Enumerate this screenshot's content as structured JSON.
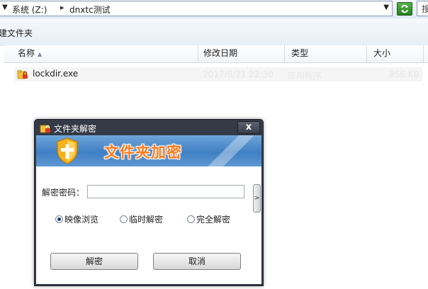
{
  "address_bar": {
    "drive": "系统 (Z:)",
    "separator": "▸",
    "folder": "dnxtc测试",
    "search_text": "搜"
  },
  "toolbar": {
    "new_folder_label": "建文件夹"
  },
  "columns": {
    "name": "名称",
    "date_modified": "修改日期",
    "type": "类型",
    "size": "大小"
  },
  "files": [
    {
      "name": "lockdir.exe",
      "date_modified": "2017/8/21 22:30",
      "type": "应用程序",
      "size": "856 KB"
    }
  ],
  "dialog": {
    "title": "文件夹解密",
    "banner_title": "文件夹加密",
    "password_label": "解密密码：",
    "password_value": "",
    "options": [
      {
        "label": "映像浏览",
        "checked": true
      },
      {
        "label": "临时解密",
        "checked": false
      },
      {
        "label": "完全解密",
        "checked": false
      }
    ],
    "unlock_button": "解密",
    "cancel_button": "取消",
    "close_glyph": "x"
  },
  "colors": {
    "banner_blue": "#3f7fc4",
    "banner_text_orange": "#ff7a1a",
    "dialog_frame": "#343b46",
    "refresh_green": "#25801e"
  }
}
